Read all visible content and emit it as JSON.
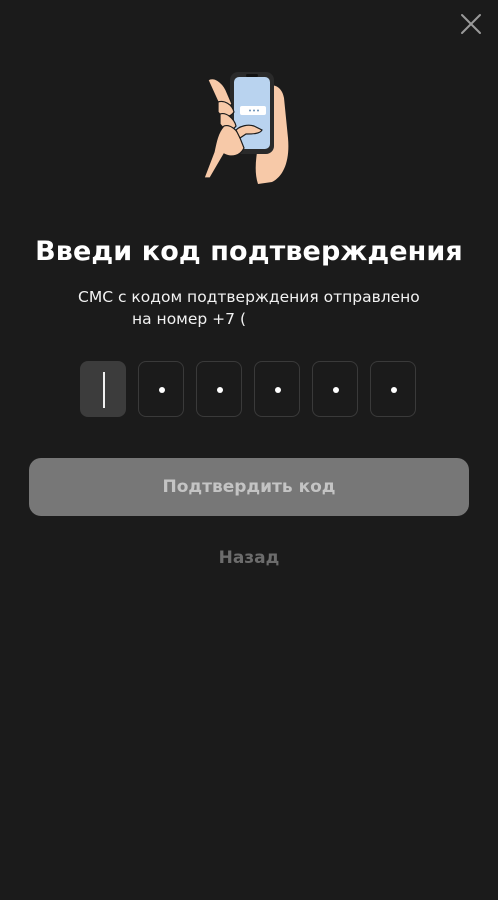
{
  "header": {
    "close_icon": "close-icon"
  },
  "illustration": {
    "icon": "hand-holding-phone-illustration"
  },
  "main": {
    "title": "Введи код подтверждения",
    "subtitle_line1": "СМС с кодом подтверждения отправлено",
    "subtitle_line2": "на номер +7 ("
  },
  "code_input": {
    "length": 6,
    "active_index": 0,
    "value": ""
  },
  "actions": {
    "confirm_label": "Подтвердить код",
    "back_label": "Назад"
  },
  "colors": {
    "background": "#1b1b1b",
    "button_disabled": "#777777",
    "button_text_disabled": "#c4c4c4",
    "link_muted": "#6c6c6c"
  }
}
